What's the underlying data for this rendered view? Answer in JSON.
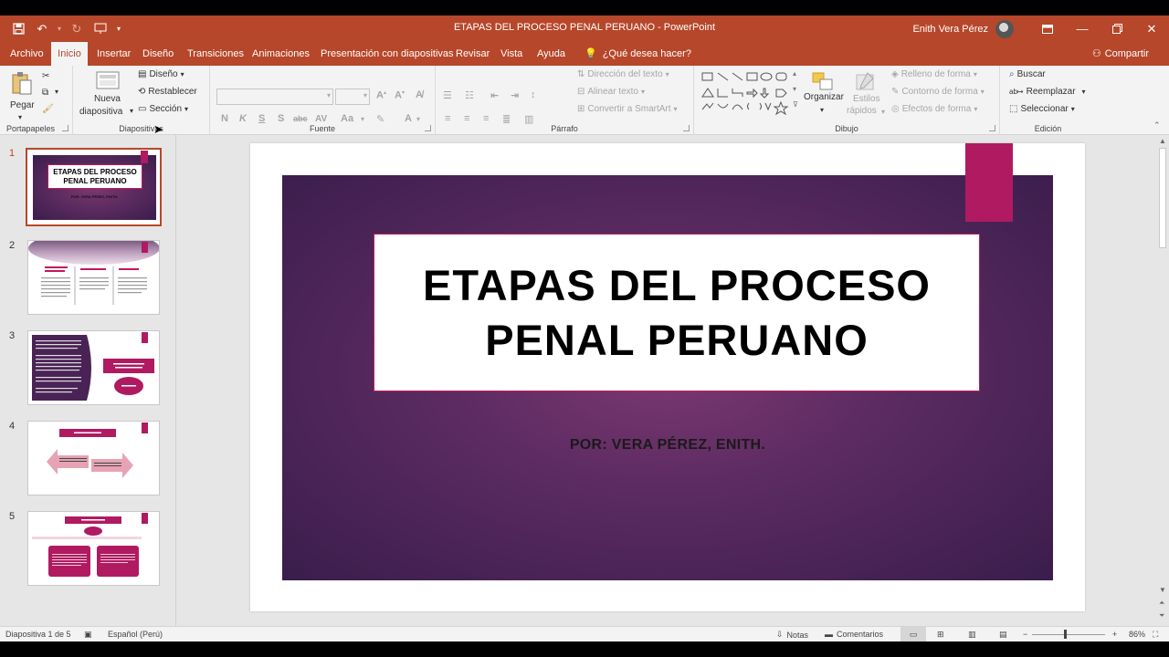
{
  "window": {
    "title": "ETAPAS DEL PROCESO PENAL PERUANO  -  PowerPoint",
    "user": "Enith Vera Pérez",
    "share_label": "Compartir"
  },
  "tabs": [
    {
      "label": "Archivo"
    },
    {
      "label": "Inicio"
    },
    {
      "label": "Insertar"
    },
    {
      "label": "Diseño"
    },
    {
      "label": "Transiciones"
    },
    {
      "label": "Animaciones"
    },
    {
      "label": "Presentación con diapositivas"
    },
    {
      "label": "Revisar"
    },
    {
      "label": "Vista"
    },
    {
      "label": "Ayuda"
    },
    {
      "label": "¿Qué desea hacer?"
    }
  ],
  "ribbon": {
    "portapapeles": {
      "label": "Portapapeles",
      "paste": "Pegar"
    },
    "diapositivas": {
      "label": "Diapositivas",
      "new_slide_1": "Nueva",
      "new_slide_2": "diapositiva",
      "layout": "Diseño",
      "reset": "Restablecer",
      "section": "Sección"
    },
    "fuente": {
      "label": "Fuente"
    },
    "parrafo": {
      "label": "Párrafo",
      "text_direction": "Dirección del texto",
      "align_text": "Alinear texto",
      "smartart": "Convertir a SmartArt"
    },
    "dibujo": {
      "label": "Dibujo",
      "arrange": "Organizar",
      "quick_styles_1": "Estilos",
      "quick_styles_2": "rápidos",
      "fill": "Relleno de forma",
      "outline": "Contorno de forma",
      "effects": "Efectos de forma"
    },
    "edicion": {
      "label": "Edición",
      "find": "Buscar",
      "replace": "Reemplazar",
      "select": "Seleccionar"
    }
  },
  "slides": [
    {
      "number": "1",
      "title": "ETAPAS DEL PROCESO PENAL PERUANO",
      "subtitle": "POR: VERA PÉREZ, ENITH."
    },
    {
      "number": "2"
    },
    {
      "number": "3"
    },
    {
      "number": "4"
    },
    {
      "number": "5"
    }
  ],
  "current_slide": {
    "title": "ETAPAS DEL PROCESO PENAL PERUANO",
    "subtitle": "POR: VERA PÉREZ, ENITH."
  },
  "status": {
    "slide_info": "Diapositiva 1 de 5",
    "language": "Español (Perú)",
    "notes": "Notas",
    "comments": "Comentarios",
    "zoom": "86%"
  },
  "colors": {
    "accent": "#b7472a",
    "slide_pink": "#b01a61",
    "slide_purple": "#5c2b62"
  }
}
